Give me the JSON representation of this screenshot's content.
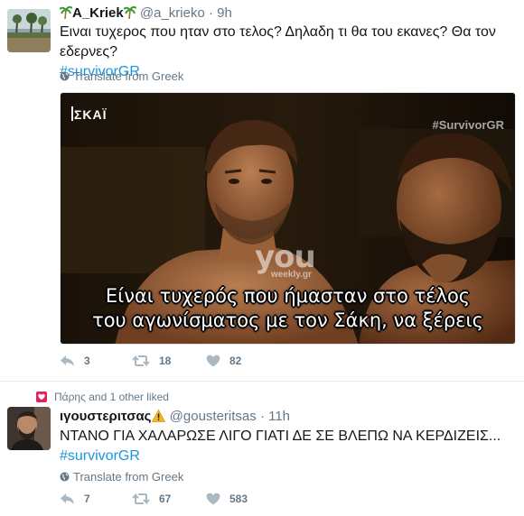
{
  "tweets": [
    {
      "display_name": "A_Kriek",
      "handle": "@a_krieko",
      "time": "9h",
      "text": "Ειναι τυχερος που ηταν στο τελος? Δηλαδη τι θα του εκανες? Θα τον εδερνες?",
      "hashtag": "#survivorGR",
      "translate": "Translate from Greek",
      "media": {
        "channel_logo": "ΣΚΑΪ",
        "tag": "#SurvivorGR",
        "watermark": "you",
        "watermark_sub": "weekly.gr",
        "subtitle_line1": "Είναι τυχερός που ήμασταν στο τέλος",
        "subtitle_line2": "του αγωνίσματος με τον Σάκη, να ξέρεις"
      },
      "actions": {
        "replies": "3",
        "retweets": "18",
        "likes": "82"
      }
    },
    {
      "social_context": "Πάρης and 1 other liked",
      "display_name": "ιγουστεριτσας",
      "handle": "@gousteritsas",
      "time": "11h",
      "text": "ΝΤΑΝΟ ΓΙΑ ΧΑΛΑΡΩΣΕ ΛΙΓΟ ΓΙΑΤΙ ΔΕ ΣΕ ΒΛΕΠΩ ΝΑ ΚΕΡΔΙΖΕΙΣ...",
      "hashtag": "#survivorGR",
      "translate": "Translate from Greek",
      "actions": {
        "replies": "7",
        "retweets": "67",
        "likes": "583"
      }
    }
  ],
  "icons": {
    "palm": "palm-tree-icon",
    "warning": "warning-icon",
    "globe": "globe-icon",
    "reply": "reply-icon",
    "retweet": "retweet-icon",
    "like": "heart-icon",
    "liked_badge": "heart-badge-icon"
  },
  "colors": {
    "link": "#1b95e0",
    "secondary_text": "#657786",
    "like_badge": "#e0245e",
    "divider": "#e6ecf0"
  }
}
